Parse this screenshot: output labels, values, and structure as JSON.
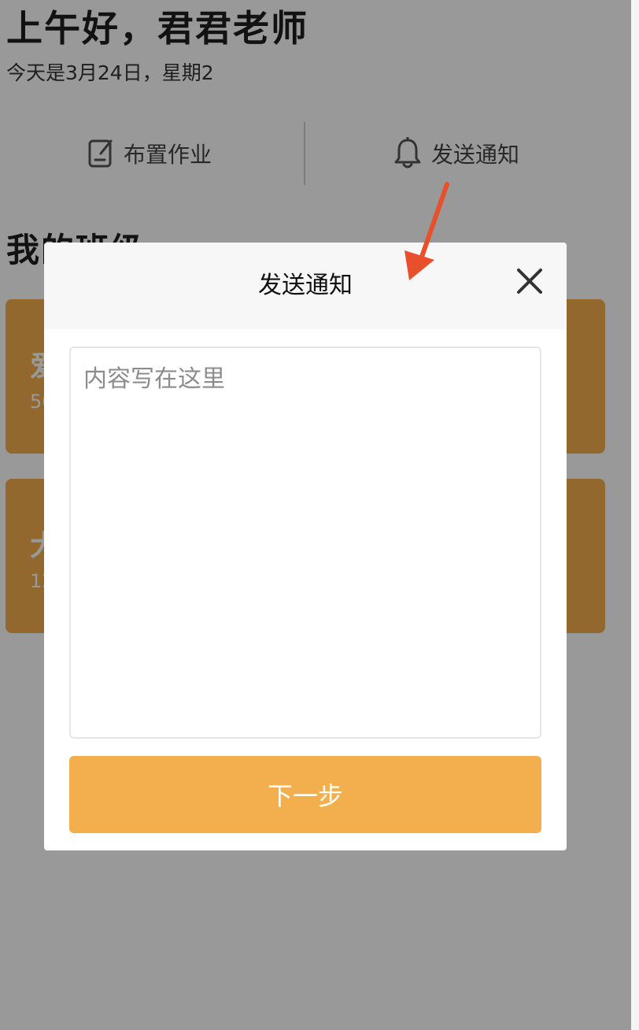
{
  "header": {
    "greeting": "上午好，君君老师",
    "date": "今天是3月24日，星期2"
  },
  "actions": {
    "assign_homework": {
      "label": "布置作业",
      "icon": "edit-icon"
    },
    "send_notice": {
      "label": "发送通知",
      "icon": "bell-icon"
    }
  },
  "my_classes": {
    "title": "我的班级",
    "cards": [
      {
        "name": "爱",
        "count": "50"
      },
      {
        "name": "大",
        "count": "12"
      }
    ]
  },
  "modal": {
    "title": "发送通知",
    "close_icon": "close-icon",
    "content_placeholder": "内容写在这里",
    "next_label": "下一步"
  },
  "colors": {
    "accent": "#f3af4d",
    "annotation_arrow": "#e8502b",
    "overlay": "rgba(0,0,0,0.40)"
  }
}
